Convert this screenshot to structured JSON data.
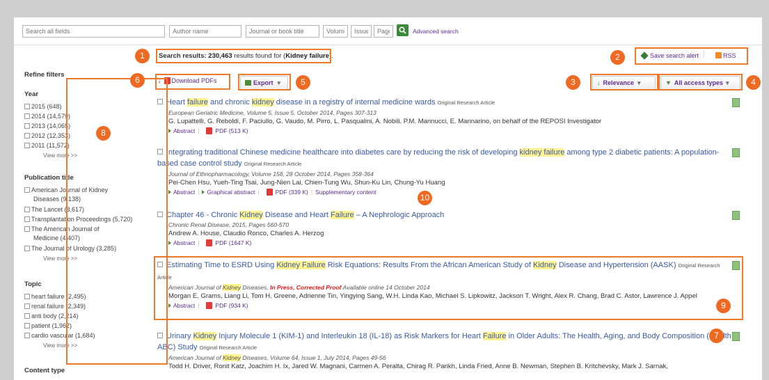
{
  "search": {
    "all_fields_placeholder": "Search all fields",
    "author_placeholder": "Author name",
    "journal_placeholder": "Journal or book title",
    "volume_placeholder": "Volume",
    "issue_placeholder": "Issue",
    "page_placeholder": "Page",
    "advanced_label": "Advanced search"
  },
  "results": {
    "prefix": "Search results: ",
    "count": "230,463",
    "middle": " results found for (",
    "query": "Kidney failure",
    "suffix": ")."
  },
  "top_actions": {
    "save_alert": "Save search alert",
    "rss": "RSS"
  },
  "toolbar": {
    "download": "Download PDFs",
    "export": "Export",
    "sort": "Relevance",
    "access": "All access types"
  },
  "sidebar": {
    "title": "Refine filters",
    "year": {
      "title": "Year",
      "items": [
        "2015 (648)",
        "2014 (14,579)",
        "2013 (14,065)",
        "2012 (12,353)",
        "2011 (11,572)"
      ],
      "more": "View more >>"
    },
    "pubtitle": {
      "title": "Publication title",
      "items": [
        "American Journal of Kidney",
        "The Lancet (8,617)",
        "Transplantation Proceedings (5,720)",
        "The American Journal of",
        "The Journal of Urology (3,285)"
      ],
      "wraps": [
        "Diseases (9,138)",
        "Medicine (4,407)"
      ],
      "more": "View more >>"
    },
    "topic": {
      "title": "Topic",
      "items": [
        "heart failure (2,495)",
        "renal failure (2,349)",
        "anti body (2,214)",
        "patient (1,962)",
        "cardio vascular (1,684)"
      ],
      "more": "View more >>"
    },
    "content_type": "Content type"
  },
  "articles": [
    {
      "t1": "Heart ",
      "h1": "failure",
      "t2": " and chronic ",
      "h2": "kidney",
      "t3": " disease in a registry of internal medicine wards",
      "type": "Original Research Article",
      "source": "European Geriatric Medicine, Volume 5, Issue 5, October 2014, Pages 307-313",
      "authors": "G. Lupattelli, G. Reboldi, F. Paciullo, G. Vaudo, M. Pirro, L. Pasqualini, A. Nobili, P.M. Mannucci, E. Mannarino, on behalf of the REPOSI Investigator",
      "abstract": "Abstract",
      "pdf": "PDF (513 K)"
    },
    {
      "t1": "Integrating traditional Chinese medicine healthcare into diabetes care by reducing the risk of developing ",
      "h1": "kidney failure",
      "t2": " among type 2 diabetic patients: A population-based case control study",
      "type": "Original Research Article",
      "source": "Journal of Ethnopharmacology, Volume 158, 28 October 2014, Pages 358-364",
      "authors": "Pei-Chen Hsu, Yueh-Ting Tsai, Jung-Nien Lai, Chien-Tung Wu, Shun-Ku Lin, Chung-Yu Huang",
      "abstract": "Abstract",
      "graphical": "Graphical abstract",
      "pdf": "PDF (339 K)",
      "supp": "Supplementary content"
    },
    {
      "t1": "Chapter 46 - Chronic ",
      "h1": "Kidney",
      "t2": " Disease and Heart ",
      "h2": "Failure",
      "t3": " – A Nephrologic Approach",
      "source": "Chronic Renal Disease, 2015, Pages 560-570",
      "authors": "Andrew A. House, Claudio Ronco, Charles A. Herzog",
      "abstract": "Abstract",
      "pdf": "PDF (1647 K)"
    },
    {
      "t1": "Estimating Time to ESRD Using ",
      "h1": "Kidney Failure",
      "t2": " Risk Equations: Results From the African American Study of ",
      "h2": "Kidney",
      "t3": " Disease and Hypertension (AASK)",
      "type": "Original Research Article",
      "source1": "American Journal of ",
      "source_hl": "Kidney",
      "source2": " Diseases, ",
      "inpress": "In Press, Corrected Proof",
      "source3": " Available online 14 October 2014",
      "authors": "Morgan E. Grams, Liang Li, Tom H. Greene, Adrienne Tin, Yingying Sang, W.H. Linda Kao, Michael S. Lipkowitz, Jackson T. Wright, Alex R. Chang, Brad C. Astor, Lawrence J. Appel",
      "abstract": "Abstract",
      "pdf": "PDF (934 K)"
    },
    {
      "t1": "Urinary ",
      "h1": "Kidney",
      "t2": " Injury Molecule 1 (KIM-1) and Interleukin 18 (IL-18) as Risk Markers for Heart ",
      "h2": "Failure",
      "t3": " in Older Adults: The Health, Aging, and Body Composition (Health ABC) Study",
      "type": "Original Research Article",
      "source1": "American Journal of ",
      "source_hl": "Kidney",
      "source2": " Diseases, Volume 64, Issue 1, July 2014, Pages 49-56",
      "authors": "Todd H. Driver, Ronit Katz, Joachim H. Ix, Jared W. Magnani, Carmen A. Peralta, Chirag R. Parikh, Linda Fried, Anne B. Newman, Stephen B. Kritchevsky, Mark J. Sarnak,"
    }
  ],
  "callouts": [
    "1",
    "2",
    "3",
    "4",
    "5",
    "6",
    "7",
    "8",
    "9",
    "10"
  ],
  "colors": {
    "accent": "#ee6a22",
    "link": "#3a5ba8",
    "highlight": "#fff38f"
  }
}
